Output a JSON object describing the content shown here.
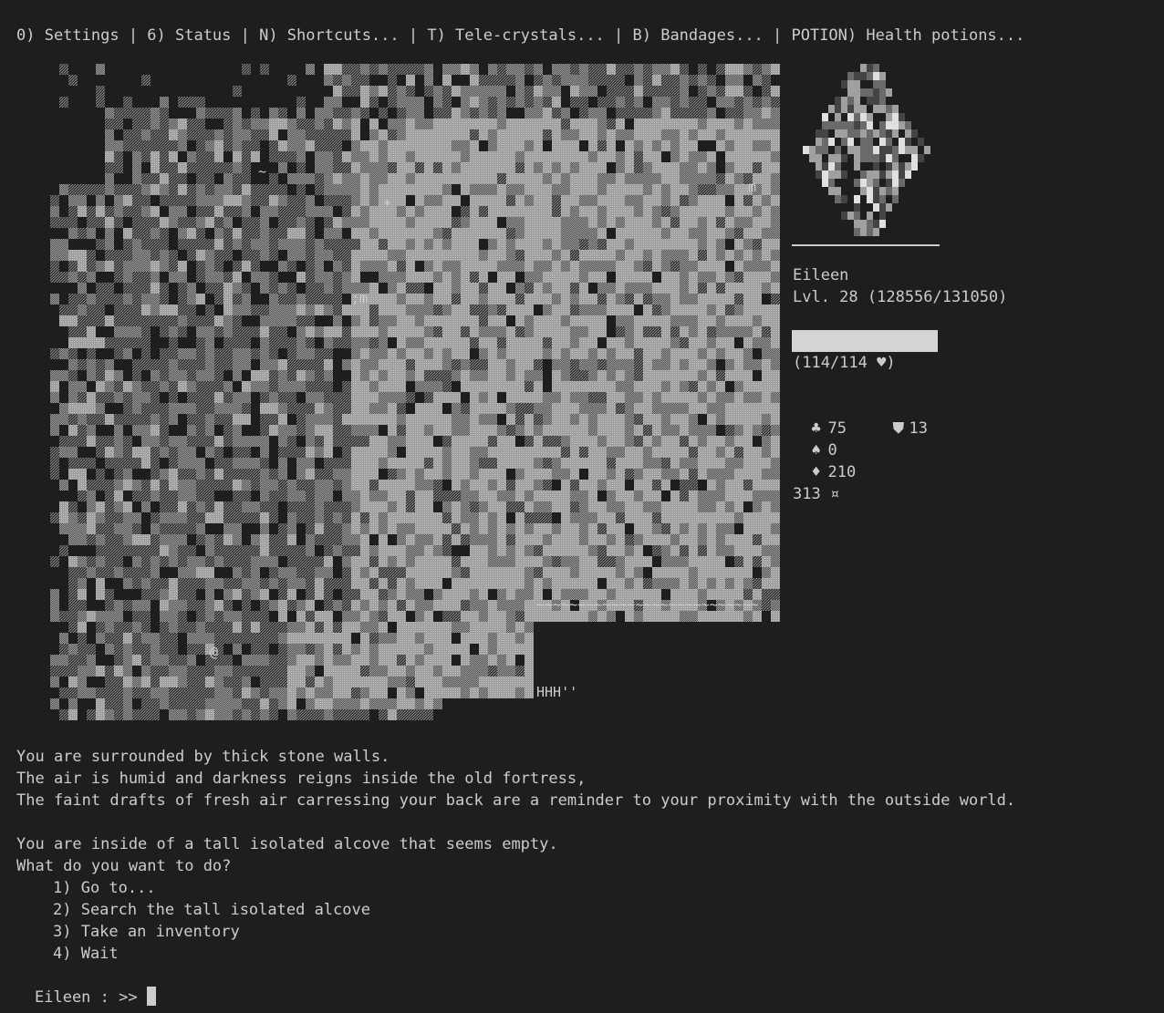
{
  "menu": {
    "text": "0) Settings | 6) Status | N) Shortcuts... | T) Tele-crystals... | B) Bandages... | POTION) Health potions..."
  },
  "player": {
    "name": "Eileen",
    "level_text": "Lvl. 28 (128556/131050)",
    "health_text": "(114/114 ♥)",
    "health_fraction": 1.0,
    "stats": {
      "club": {
        "icon": "♣",
        "value": "75"
      },
      "shield": {
        "icon": "⛊",
        "value": "13"
      },
      "spade": {
        "icon": "♠",
        "value": "0"
      },
      "diamond": {
        "icon": "♦",
        "value": "210"
      },
      "currency_text": "313 ¤"
    }
  },
  "narration": {
    "line1": "You are surrounded by thick stone walls.",
    "line2": "The air is humid and darkness reigns inside the old fortress,",
    "line3": "The faint drafts of fresh air carressing your back are a reminder to your proximity with the outside world.",
    "line4": "You are inside of a tall isolated alcove that seems empty.",
    "question": "What do you want to do?"
  },
  "options": [
    "1) Go to...",
    "2) Search the tall isolated alcove",
    "3) Take an inventory",
    "4) Wait"
  ],
  "prompt": {
    "text": "Eileen : >> "
  },
  "colors": {
    "background": "#1e1e1e",
    "text": "#cccccc",
    "wall_dark": "#5e5e5e",
    "wall_light": "#a8a8a8",
    "highlight": "#e0e0e0"
  }
}
